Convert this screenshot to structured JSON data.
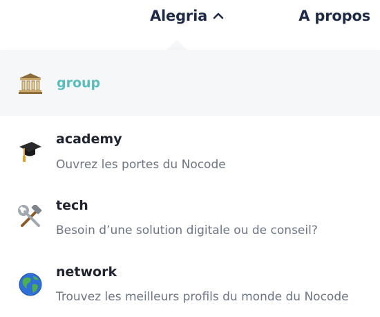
{
  "nav": {
    "menu_label": "Alegria",
    "about_label": "A propos"
  },
  "dropdown": {
    "group": {
      "label": "group",
      "icon": "classical-building-icon",
      "color": "#5bbcbc"
    },
    "items": [
      {
        "title": "academy",
        "description": "Ouvrez les portes du Nocode",
        "icon": "graduation-cap-icon"
      },
      {
        "title": "tech",
        "description": "Besoin d’une solution digitale ou de conseil?",
        "icon": "hammer-and-wrench-icon"
      },
      {
        "title": "network",
        "description": "Trouvez les meilleurs profils du monde du Nocode",
        "icon": "globe-icon"
      }
    ]
  },
  "colors": {
    "text_dark": "#1f2a44",
    "muted": "#6d7583",
    "highlight_bg": "#f6f7f9",
    "accent": "#5bbcbc"
  }
}
